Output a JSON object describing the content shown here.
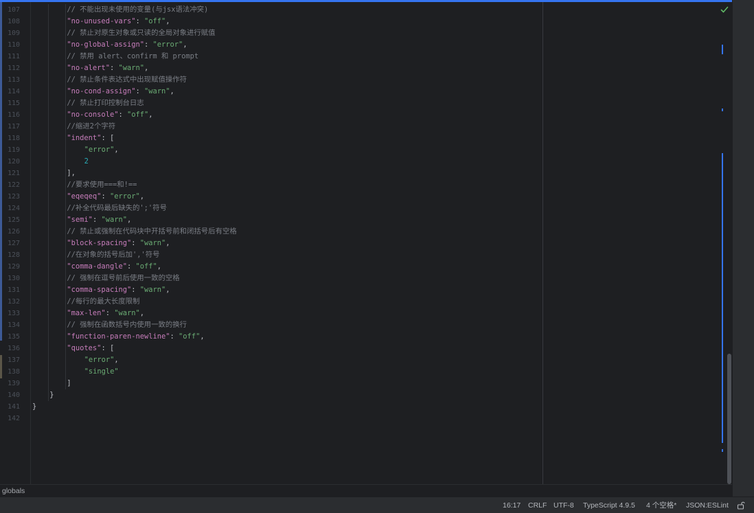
{
  "editor": {
    "lines": [
      {
        "n": "107",
        "indent": 2,
        "tokens": [
          [
            "c-com",
            "// 不能出现未使用的变量(与jsx语法冲突)"
          ]
        ]
      },
      {
        "n": "108",
        "indent": 2,
        "tokens": [
          [
            "c-key",
            "\"no-unused-vars\""
          ],
          [
            "c-pun",
            ": "
          ],
          [
            "c-str",
            "\"off\""
          ],
          [
            "c-pun",
            ","
          ]
        ]
      },
      {
        "n": "109",
        "indent": 2,
        "tokens": [
          [
            "c-com",
            "// 禁止对原生对象或只读的全局对象进行赋值"
          ]
        ]
      },
      {
        "n": "110",
        "indent": 2,
        "tokens": [
          [
            "c-key",
            "\"no-global-assign\""
          ],
          [
            "c-pun",
            ": "
          ],
          [
            "c-str",
            "\"error\""
          ],
          [
            "c-pun",
            ","
          ]
        ]
      },
      {
        "n": "111",
        "indent": 2,
        "tokens": [
          [
            "c-com",
            "// 禁用 alert、confirm 和 prompt"
          ]
        ]
      },
      {
        "n": "112",
        "indent": 2,
        "tokens": [
          [
            "c-key",
            "\"no-alert\""
          ],
          [
            "c-pun",
            ": "
          ],
          [
            "c-str",
            "\"warn\""
          ],
          [
            "c-pun",
            ","
          ]
        ]
      },
      {
        "n": "113",
        "indent": 2,
        "tokens": [
          [
            "c-com",
            "// 禁止条件表达式中出现赋值操作符"
          ]
        ]
      },
      {
        "n": "114",
        "indent": 2,
        "tokens": [
          [
            "c-key",
            "\"no-cond-assign\""
          ],
          [
            "c-pun",
            ": "
          ],
          [
            "c-str",
            "\"warn\""
          ],
          [
            "c-pun",
            ","
          ]
        ]
      },
      {
        "n": "115",
        "indent": 2,
        "tokens": [
          [
            "c-com",
            "// 禁止打印控制台日志"
          ]
        ]
      },
      {
        "n": "116",
        "indent": 2,
        "tokens": [
          [
            "c-key",
            "\"no-console\""
          ],
          [
            "c-pun",
            ": "
          ],
          [
            "c-str",
            "\"off\""
          ],
          [
            "c-pun",
            ","
          ]
        ]
      },
      {
        "n": "117",
        "indent": 2,
        "tokens": [
          [
            "c-com",
            "//缩进2个字符"
          ]
        ]
      },
      {
        "n": "118",
        "indent": 2,
        "tokens": [
          [
            "c-key",
            "\"indent\""
          ],
          [
            "c-pun",
            ": ["
          ]
        ]
      },
      {
        "n": "119",
        "indent": 3,
        "tokens": [
          [
            "c-str",
            "\"error\""
          ],
          [
            "c-pun",
            ","
          ]
        ]
      },
      {
        "n": "120",
        "indent": 3,
        "tokens": [
          [
            "c-num",
            "2"
          ]
        ]
      },
      {
        "n": "121",
        "indent": 2,
        "tokens": [
          [
            "c-pun",
            "],"
          ]
        ]
      },
      {
        "n": "122",
        "indent": 2,
        "tokens": [
          [
            "c-com",
            "//要求使用===和!=="
          ]
        ]
      },
      {
        "n": "123",
        "indent": 2,
        "tokens": [
          [
            "c-key",
            "\"eqeqeq\""
          ],
          [
            "c-pun",
            ": "
          ],
          [
            "c-str",
            "\"error\""
          ],
          [
            "c-pun",
            ","
          ]
        ]
      },
      {
        "n": "124",
        "indent": 2,
        "tokens": [
          [
            "c-com",
            "//补全代码最后缺失的';'符号"
          ]
        ]
      },
      {
        "n": "125",
        "indent": 2,
        "tokens": [
          [
            "c-key",
            "\"semi\""
          ],
          [
            "c-pun",
            ": "
          ],
          [
            "c-str",
            "\"warn\""
          ],
          [
            "c-pun",
            ","
          ]
        ]
      },
      {
        "n": "126",
        "indent": 2,
        "tokens": [
          [
            "c-com",
            "// 禁止或强制在代码块中开括号前和闭括号后有空格"
          ]
        ]
      },
      {
        "n": "127",
        "indent": 2,
        "tokens": [
          [
            "c-key",
            "\"block-spacing\""
          ],
          [
            "c-pun",
            ": "
          ],
          [
            "c-str",
            "\"warn\""
          ],
          [
            "c-pun",
            ","
          ]
        ]
      },
      {
        "n": "128",
        "indent": 2,
        "tokens": [
          [
            "c-com",
            "//在对象的括号后加','符号"
          ]
        ]
      },
      {
        "n": "129",
        "indent": 2,
        "tokens": [
          [
            "c-key",
            "\"comma-dangle\""
          ],
          [
            "c-pun",
            ": "
          ],
          [
            "c-str",
            "\"off\""
          ],
          [
            "c-pun",
            ","
          ]
        ]
      },
      {
        "n": "130",
        "indent": 2,
        "tokens": [
          [
            "c-com",
            "// 强制在逗号前后使用一致的空格"
          ]
        ]
      },
      {
        "n": "131",
        "indent": 2,
        "tokens": [
          [
            "c-key",
            "\"comma-spacing\""
          ],
          [
            "c-pun",
            ": "
          ],
          [
            "c-str",
            "\"warn\""
          ],
          [
            "c-pun",
            ","
          ]
        ]
      },
      {
        "n": "132",
        "indent": 2,
        "tokens": [
          [
            "c-com",
            "//每行的最大长度限制"
          ]
        ]
      },
      {
        "n": "133",
        "indent": 2,
        "tokens": [
          [
            "c-key",
            "\"max-len\""
          ],
          [
            "c-pun",
            ": "
          ],
          [
            "c-str",
            "\"warn\""
          ],
          [
            "c-pun",
            ","
          ]
        ]
      },
      {
        "n": "134",
        "indent": 2,
        "tokens": [
          [
            "c-com",
            "// 强制在函数括号内使用一致的换行"
          ]
        ]
      },
      {
        "n": "135",
        "indent": 2,
        "tokens": [
          [
            "c-key",
            "\"function-paren-newline\""
          ],
          [
            "c-pun",
            ": "
          ],
          [
            "c-str",
            "\"off\""
          ],
          [
            "c-pun",
            ","
          ]
        ]
      },
      {
        "n": "136",
        "indent": 2,
        "tokens": [
          [
            "c-key",
            "\"quotes\""
          ],
          [
            "c-pun",
            ": ["
          ]
        ]
      },
      {
        "n": "137",
        "indent": 3,
        "tokens": [
          [
            "c-str",
            "\"error\""
          ],
          [
            "c-pun",
            ","
          ]
        ]
      },
      {
        "n": "138",
        "indent": 3,
        "tokens": [
          [
            "c-str",
            "\"single\""
          ]
        ]
      },
      {
        "n": "139",
        "indent": 2,
        "tokens": [
          [
            "c-pun",
            "]"
          ]
        ]
      },
      {
        "n": "140",
        "indent": 1,
        "tokens": [
          [
            "c-pun",
            "}"
          ]
        ]
      },
      {
        "n": "141",
        "indent": 0,
        "tokens": [
          [
            "c-pun",
            "}"
          ]
        ]
      },
      {
        "n": "142",
        "indent": 0,
        "tokens": []
      }
    ],
    "inspection_icon": "check-icon"
  },
  "breadcrumb": {
    "label": "globals"
  },
  "statusbar": {
    "position": "16:17",
    "line_separator": "CRLF",
    "encoding": "UTF-8",
    "language_service": "TypeScript 4.9.5",
    "indent": "4 个空格*",
    "schema": "JSON:ESLint",
    "lock_icon": "lock-icon"
  },
  "colors": {
    "keyword": "#c77dbb",
    "string": "#6aab73",
    "number": "#2aacb8",
    "comment": "#7a7e85",
    "accent": "#3574f0"
  }
}
